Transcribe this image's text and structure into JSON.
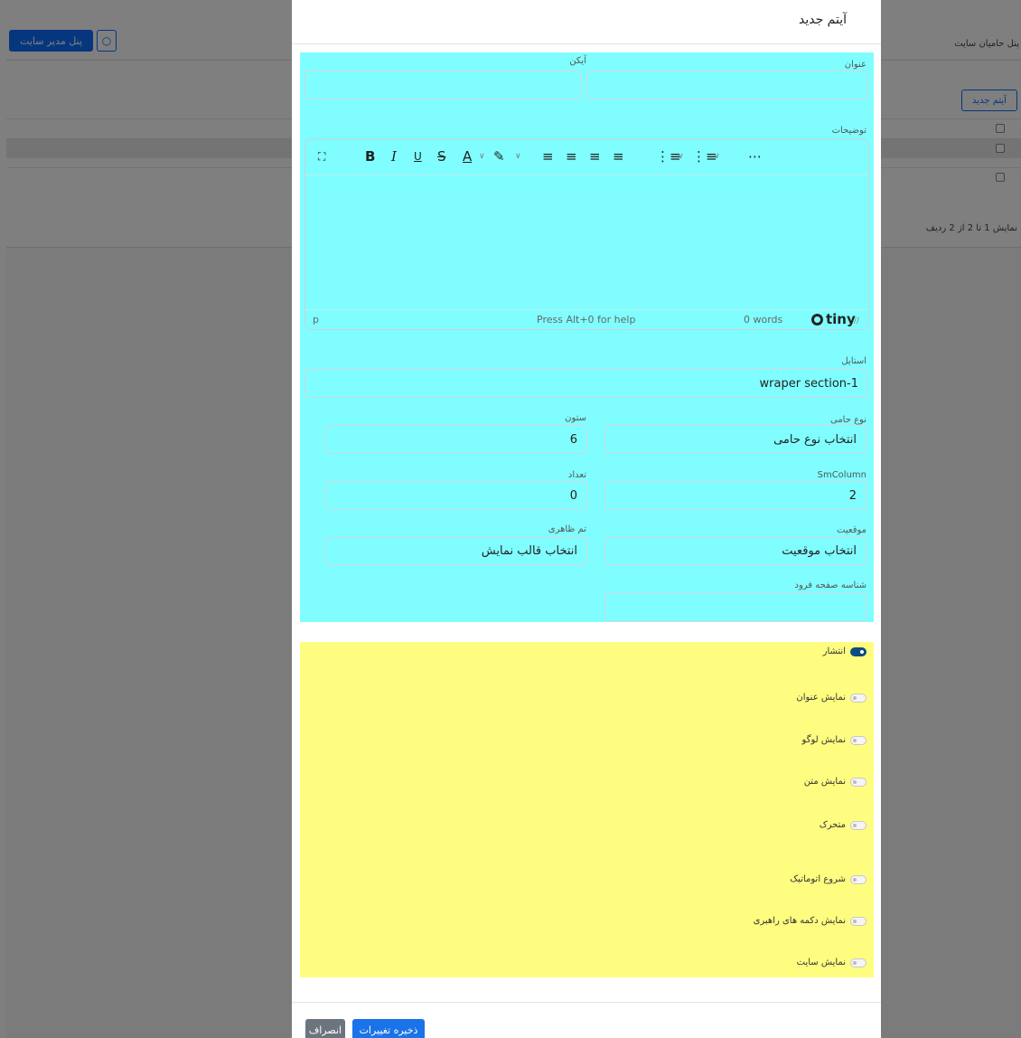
{
  "background": {
    "header": {
      "admin_panel_button": "پنل مدیر سایت",
      "bulb_icon": "lightbulb-icon",
      "site_title": "پنل حامیان سایت"
    },
    "table": {
      "new_item_button": "آیتم جدید",
      "rows_info": "نمایش 1 تا 2 از 2 ردیف"
    }
  },
  "modal": {
    "title": "آیتم جدید",
    "fields": {
      "title_label": "عنوان",
      "title_value": "",
      "icon_label": "آیکن",
      "icon_value": "",
      "description_label": "توضیحات",
      "style_label": "استایل",
      "style_value": "wraper section-1",
      "sponsor_type_label": "نوع حامی",
      "sponsor_type_value": "انتخاب نوع حامی",
      "column_label": "ستون",
      "column_value": "6",
      "sm_column_label": "SmColumn",
      "sm_column_value": "2",
      "count_label": "تعداد",
      "count_value": "0",
      "position_label": "موقعیت",
      "position_value": "انتخاب موقعیت",
      "theme_label": "تم ظاهری",
      "theme_value": "انتخاب قالب نمایش",
      "landing_id_label": "شناسه صفحه فرود",
      "landing_id_value": ""
    },
    "editor": {
      "toolbar": [
        "fullscreen-icon",
        "bold-icon",
        "italic-icon",
        "underline-icon",
        "strikethrough-icon",
        "text-color-icon",
        "highlight-icon",
        "align-left-icon",
        "align-center-icon",
        "align-right-icon",
        "justify-icon",
        "bullet-list-icon",
        "numbered-list-icon",
        "more-icon"
      ],
      "status_path": "p",
      "status_help": "Press Alt+0 for help",
      "status_words": "0 words",
      "brand": "tiny"
    },
    "toggles": [
      {
        "label": "انتشار",
        "on": true
      },
      {
        "label": "نمایش عنوان",
        "on": false
      },
      {
        "label": "نمایش لوگو",
        "on": false
      },
      {
        "label": "نمایش متن",
        "on": false
      },
      {
        "label": "متحرک",
        "on": false
      },
      {
        "label": "شروع اتوماتیک",
        "on": false
      },
      {
        "label": "نمایش دکمه های راهبری",
        "on": false
      },
      {
        "label": "نمایش سایت",
        "on": false
      }
    ],
    "footer": {
      "save_button": "ذخیره تغییرات",
      "cancel_button": "انصراف"
    }
  },
  "colors": {
    "form_highlight": "#80feff",
    "toggle_highlight": "#fffd80",
    "primary": "#0d6efd",
    "toggle_on": "#0f4c81"
  }
}
